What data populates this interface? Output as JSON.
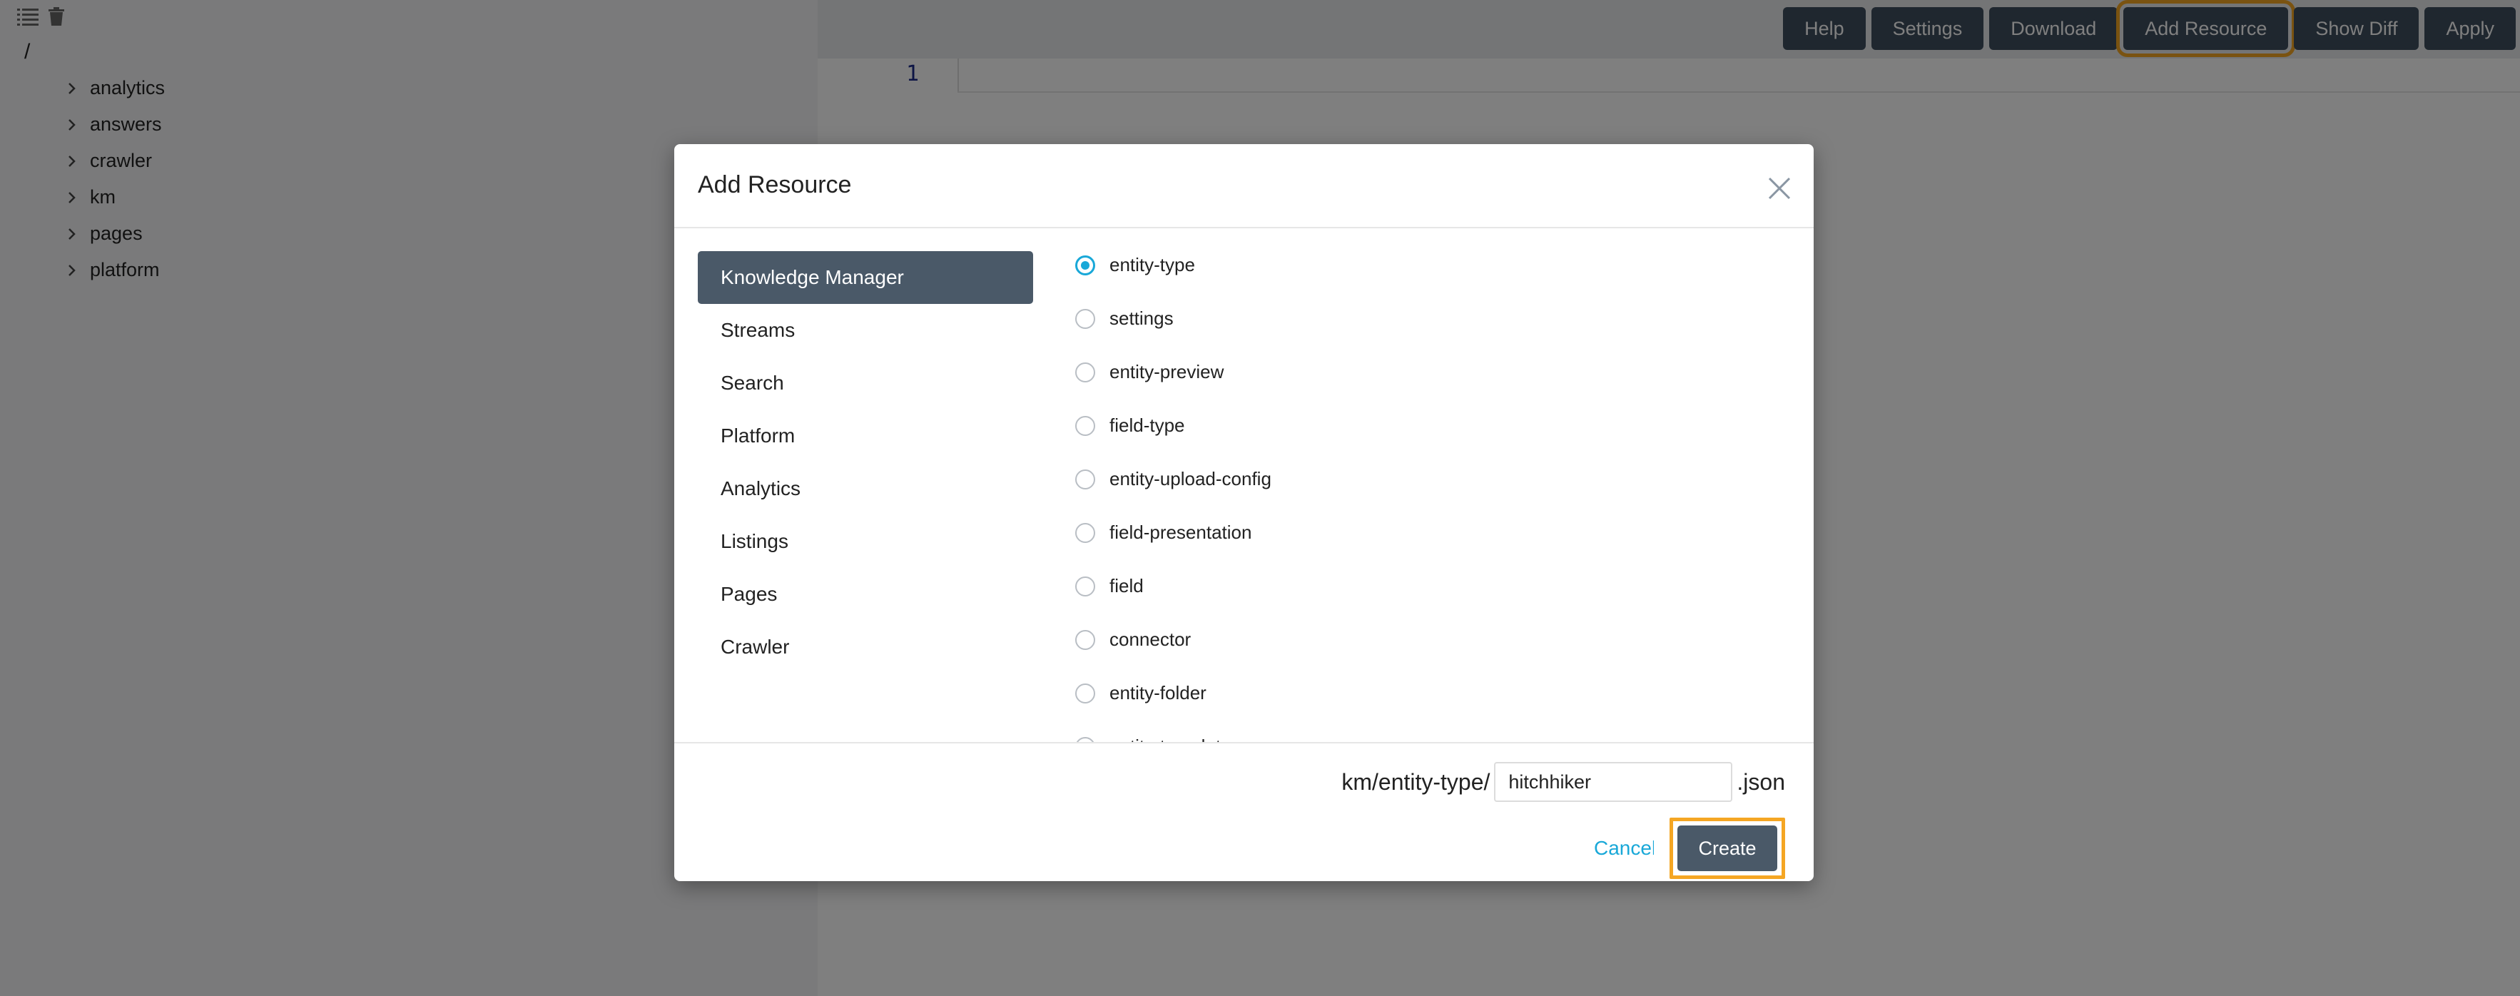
{
  "sidebar": {
    "tools": [
      "list-icon",
      "trash-icon"
    ],
    "root": "/",
    "tree": [
      {
        "label": "analytics"
      },
      {
        "label": "answers"
      },
      {
        "label": "crawler"
      },
      {
        "label": "km"
      },
      {
        "label": "pages"
      },
      {
        "label": "platform"
      }
    ]
  },
  "toolbar": {
    "buttons": [
      "Help",
      "Settings",
      "Download",
      "Add Resource",
      "Show Diff",
      "Apply"
    ]
  },
  "editor": {
    "line_number": "1"
  },
  "modal": {
    "title": "Add Resource",
    "categories": [
      "Knowledge Manager",
      "Streams",
      "Search",
      "Platform",
      "Analytics",
      "Listings",
      "Pages",
      "Crawler"
    ],
    "active_category": "Knowledge Manager",
    "options": [
      "entity-type",
      "settings",
      "entity-preview",
      "field-type",
      "entity-upload-config",
      "field-presentation",
      "field",
      "connector",
      "entity-folder",
      "entity-template"
    ],
    "selected_option": "entity-type",
    "path_prefix": "km/entity-type/",
    "filename_value": "hitchhiker",
    "path_suffix": ".json",
    "cancel_label": "Cancel",
    "create_label": "Create"
  },
  "colors": {
    "accent": "#19a8d8",
    "dark_button": "#3f4e5e",
    "highlight": "#f5a623"
  }
}
